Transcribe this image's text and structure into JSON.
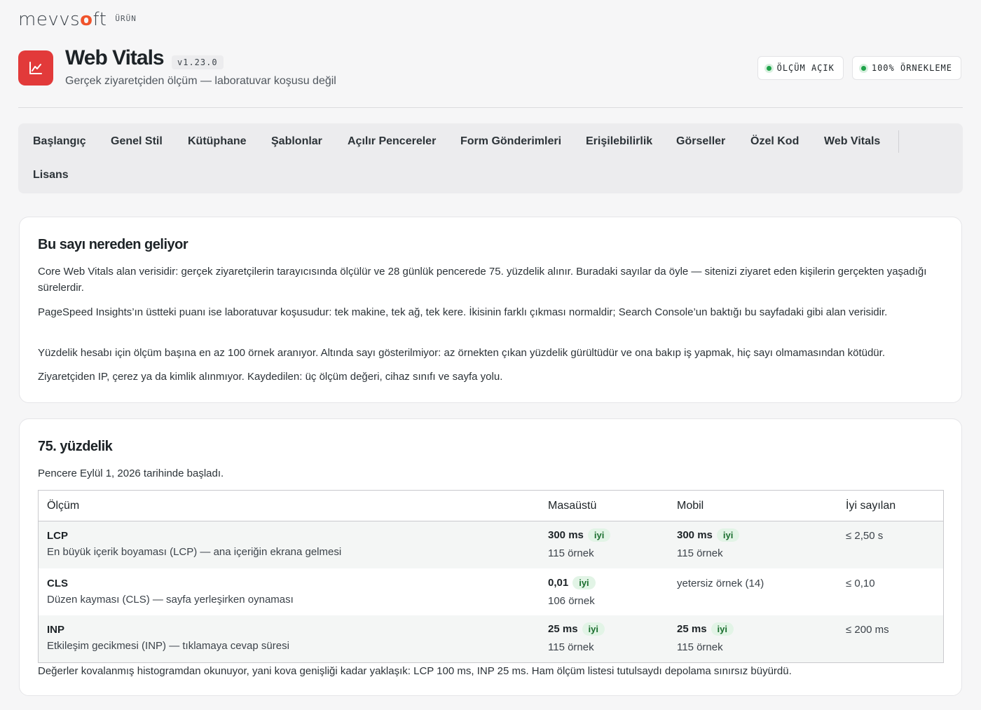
{
  "brand": {
    "logo_prefix": "mevvs",
    "logo_o": "o",
    "logo_suffix": "ft",
    "tag": "ÜRÜN"
  },
  "header": {
    "title": "Web Vitals",
    "version": "v1.23.0",
    "subtitle": "Gerçek ziyaretçiden ölçüm — laboratuvar koşusu değil",
    "badges": [
      "ÖLÇÜM AÇIK",
      "100% ÖRNEKLEME"
    ],
    "icon": "chart-line-icon"
  },
  "nav": {
    "items": [
      "Başlangıç",
      "Genel Stil",
      "Kütüphane",
      "Şablonlar",
      "Açılır Pencereler",
      "Form Gönderimleri",
      "Erişilebilirlik",
      "Görseller",
      "Özel Kod",
      "Web Vitals",
      "Lisans"
    ]
  },
  "source_card": {
    "title": "Bu sayı nereden geliyor",
    "paragraphs": [
      "Core Web Vitals alan verisidir: gerçek ziyaretçilerin tarayıcısında ölçülür ve 28 günlük pencerede 75. yüzdelik alınır. Buradaki sayılar da öyle — sitenizi ziyaret eden kişilerin gerçekten yaşadığı sürelerdir.",
      "PageSpeed Insights’ın üstteki puanı ise laboratuvar koşusudur: tek makine, tek ağ, tek kere. İkisinin farklı çıkması normaldir; Search Console’un baktığı bu sayfadaki gibi alan verisidir.",
      "Yüzdelik hesabı için ölçüm başına en az 100 örnek aranıyor. Altında sayı gösterilmiyor: az örnekten çıkan yüzdelik gürültüdür ve ona bakıp iş yapmak, hiç sayı olmamasından kötüdür.",
      "Ziyaretçiden IP, çerez ya da kimlik alınmıyor. Kaydedilen: üç ölçüm değeri, cihaz sınıfı ve sayfa yolu."
    ]
  },
  "percentile_card": {
    "title": "75. yüzdelik",
    "window_text": "Pencere Eylül 1, 2026 tarihinde başladı.",
    "columns": [
      "Ölçüm",
      "Masaüstü",
      "Mobil",
      "İyi sayılan"
    ],
    "rows": [
      {
        "metric": "LCP",
        "desc": "En büyük içerik boyaması (LCP) — ana içeriğin ekrana gelmesi",
        "desktop_val": "300 ms",
        "desktop_rating": "iyi",
        "desktop_samples": "115 örnek",
        "mobile_val": "300 ms",
        "mobile_rating": "iyi",
        "mobile_samples": "115 örnek",
        "threshold": "≤ 2,50 s"
      },
      {
        "metric": "CLS",
        "desc": "Düzen kayması (CLS) — sayfa yerleşirken oynaması",
        "desktop_val": "0,01",
        "desktop_rating": "iyi",
        "desktop_samples": "106 örnek",
        "mobile_text": "yetersiz örnek (14)",
        "threshold": "≤ 0,10"
      },
      {
        "metric": "INP",
        "desc": "Etkileşim gecikmesi (INP) — tıklamaya cevap süresi",
        "desktop_val": "25 ms",
        "desktop_rating": "iyi",
        "desktop_samples": "115 örnek",
        "mobile_val": "25 ms",
        "mobile_rating": "iyi",
        "mobile_samples": "115 örnek",
        "threshold": "≤ 200 ms"
      }
    ],
    "footnote": "Değerler kovalanmış histogramdan okunuyor, yani kova genişliği kadar yaklaşık: LCP 100 ms, INP 25 ms. Ham ölçüm listesi tutulsaydı depolama sınırsız büyürdü."
  },
  "colors": {
    "accent": "#e23a3a",
    "good": "#1fa34a",
    "brand_o": "#f0532b"
  }
}
